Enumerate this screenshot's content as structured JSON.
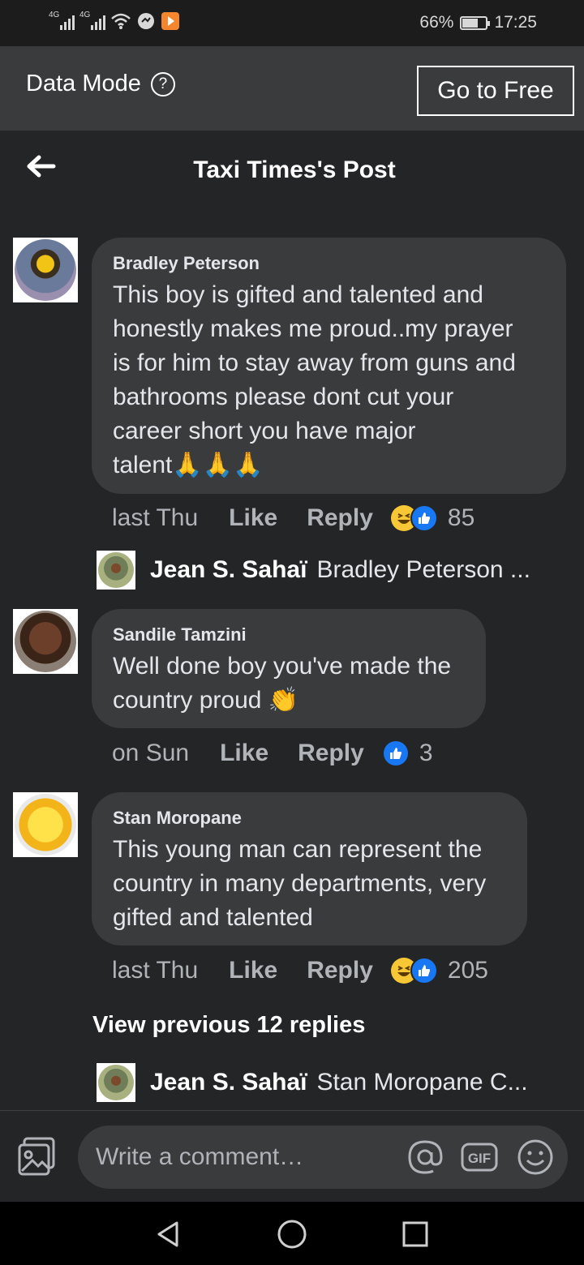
{
  "status_bar": {
    "network_1": "4G",
    "network_2": "4G",
    "battery": "66%",
    "battery_level": 0.66,
    "time": "17:25"
  },
  "data_mode": {
    "label": "Data Mode",
    "free_button": "Go to Free"
  },
  "header": {
    "title": "Taxi Times's Post"
  },
  "comments": [
    {
      "author": "Bradley Peterson",
      "lines": [
        "This boy is gifted and talented and",
        "honestly makes me proud..my prayer",
        "is for him to stay away from guns and",
        "bathrooms please dont cut your",
        "career short you have major",
        "talent🙏🙏🙏"
      ],
      "time": "last Thu",
      "like": "Like",
      "reply": "Reply",
      "reactions": [
        "haha",
        "like"
      ],
      "count": "85",
      "reply_preview": {
        "name": "Jean S. Sahaï",
        "text": "Bradley Peterson ..."
      }
    },
    {
      "author": "Sandile Tamzini",
      "lines": [
        "Well done boy you've made the",
        "country proud 👏"
      ],
      "time": "on Sun",
      "like": "Like",
      "reply": "Reply",
      "reactions": [
        "like"
      ],
      "count": "3"
    },
    {
      "author": "Stan Moropane",
      "lines": [
        "This young man can represent the",
        "country in many departments, very",
        "gifted and talented"
      ],
      "time": "last Thu",
      "like": "Like",
      "reply": "Reply",
      "reactions": [
        "haha",
        "like"
      ],
      "count": "205",
      "view_previous": "View previous 12 replies",
      "reply_preview": {
        "name": "Jean S. Sahaï",
        "text": "Stan Moropane C..."
      }
    }
  ],
  "composer": {
    "placeholder": "Write a comment…",
    "icons": [
      "photo-icon",
      "mention-icon",
      "gif-icon",
      "emoji-icon"
    ],
    "gif_label": "GIF"
  },
  "colors": {
    "background": "#242526",
    "bubble": "#3a3b3c",
    "like_blue": "#1877f2",
    "haha_yellow": "#f7c736"
  }
}
